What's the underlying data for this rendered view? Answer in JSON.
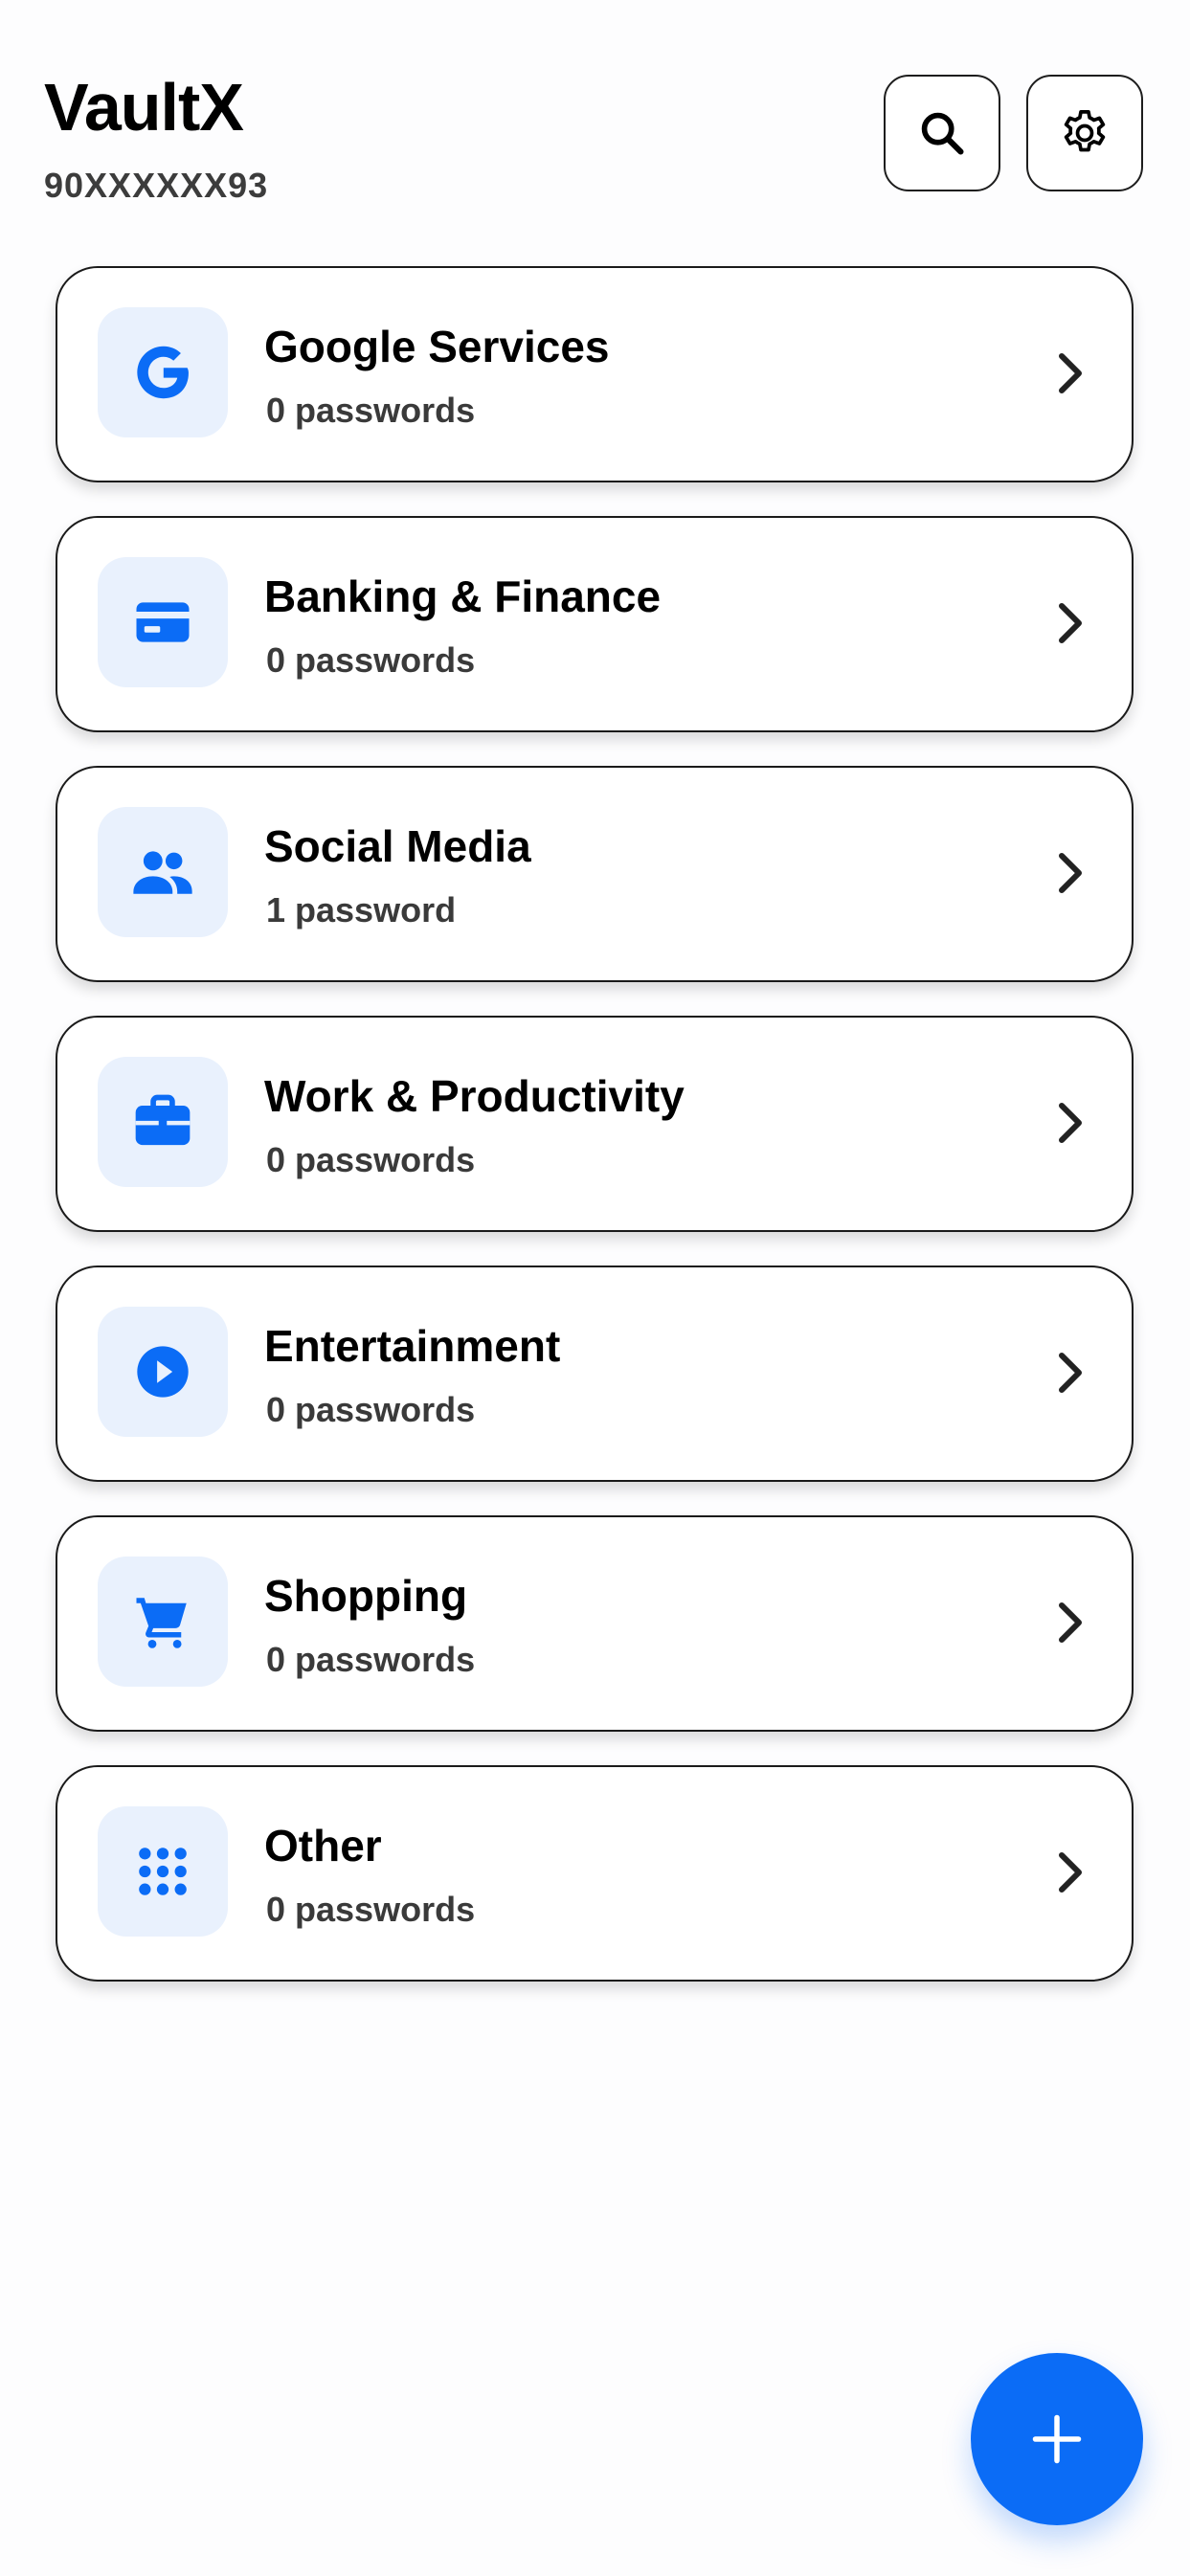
{
  "header": {
    "title": "VaultX",
    "subtitle": "90XXXXXX93",
    "search_icon": "search-icon",
    "settings_icon": "gear-icon"
  },
  "colors": {
    "accent": "#0b6cf6",
    "icon_bg": "#e9f1fd",
    "card_border": "#1a1a1a"
  },
  "categories": [
    {
      "title": "Google Services",
      "count": "0 passwords",
      "icon": "google-icon"
    },
    {
      "title": "Banking & Finance",
      "count": "0 passwords",
      "icon": "credit-card-icon"
    },
    {
      "title": "Social Media",
      "count": "1 password",
      "icon": "people-icon"
    },
    {
      "title": "Work & Productivity",
      "count": "0 passwords",
      "icon": "briefcase-icon"
    },
    {
      "title": "Entertainment",
      "count": "0 passwords",
      "icon": "play-icon"
    },
    {
      "title": "Shopping",
      "count": "0 passwords",
      "icon": "cart-icon"
    },
    {
      "title": "Other",
      "count": "0 passwords",
      "icon": "grid-icon"
    }
  ],
  "fab": {
    "icon": "plus-icon"
  }
}
